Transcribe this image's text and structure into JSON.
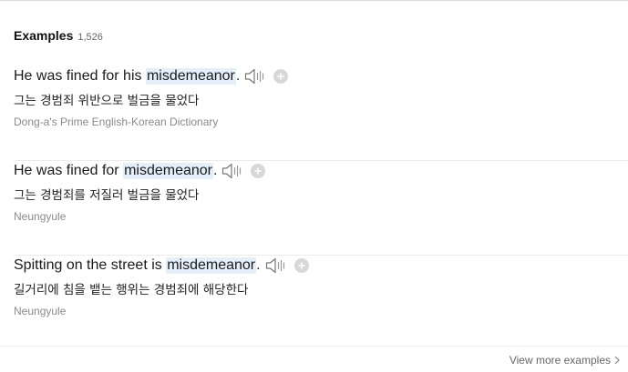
{
  "section": {
    "title": "Examples",
    "count": "1,526"
  },
  "examples": [
    {
      "before": "He was fined for his ",
      "keyword": "misdemeanor",
      "after": ".",
      "translation": "그는 경범죄 위반으로 벌금을 물었다",
      "source": "Dong-a's Prime English-Korean Dictionary"
    },
    {
      "before": "He was fined for ",
      "keyword": "misdemeanor",
      "after": ".",
      "translation": "그는 경범죄를 저질러 벌금을 물었다",
      "source": "Neungyule"
    },
    {
      "before": "Spitting on the street is ",
      "keyword": "misdemeanor",
      "after": ".",
      "translation": "길거리에 침을 뱉는 행위는 경범죄에 해당한다",
      "source": "Neungyule"
    }
  ],
  "footer": {
    "view_more": "View more examples"
  },
  "icons": {
    "speaker": "speaker-icon",
    "add": "plus-icon",
    "chevron": "chevron-right-icon"
  },
  "colors": {
    "keyword_highlight": "#e3f0fb",
    "add_button": "#d8d8d8",
    "source_text": "#8a8a8a"
  }
}
